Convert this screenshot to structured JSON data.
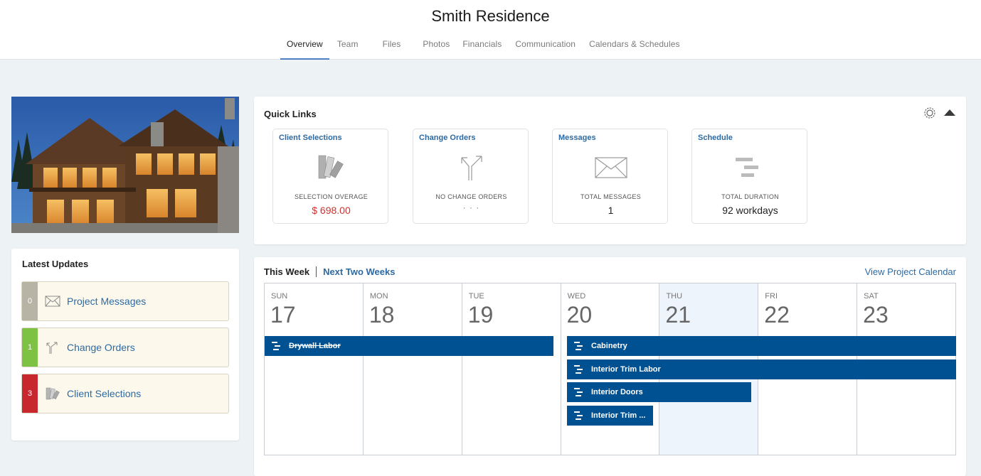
{
  "project": {
    "title": "Smith Residence"
  },
  "nav": {
    "tabs": [
      {
        "label": "Overview",
        "active": true
      },
      {
        "label": "Team"
      },
      {
        "label": "Files"
      },
      {
        "label": "Photos"
      },
      {
        "label": "Financials"
      },
      {
        "label": "Communication"
      },
      {
        "label": "Calendars & Schedules"
      }
    ]
  },
  "updates": {
    "title": "Latest Updates",
    "items": [
      {
        "count": "0",
        "label": "Project Messages",
        "icon": "envelope-icon",
        "color": "#b7b4a6"
      },
      {
        "count": "1",
        "label": "Change Orders",
        "icon": "change-order-arrows-icon",
        "color": "#7dc242"
      },
      {
        "count": "3",
        "label": "Client Selections",
        "icon": "swatch-icon",
        "color": "#c8272d"
      }
    ]
  },
  "quick_links": {
    "title": "Quick Links",
    "tiles": [
      {
        "name": "Client Selections",
        "icon": "swatch-icon",
        "sub": "SELECTION OVERAGE",
        "value": "$ 698.00"
      },
      {
        "name": "Change Orders",
        "icon": "change-order-arrows-icon",
        "sub": "NO CHANGE ORDERS",
        "value": "· · ·"
      },
      {
        "name": "Messages",
        "icon": "envelope-icon",
        "sub": "TOTAL MESSAGES",
        "value": "1"
      },
      {
        "name": "Schedule",
        "icon": "gantt-icon",
        "sub": "TOTAL DURATION",
        "value": "92 workdays"
      }
    ]
  },
  "calendar": {
    "tab_this_week": "This Week",
    "tab_next_two": "Next Two Weeks",
    "view_link": "View Project Calendar",
    "days": [
      {
        "dow": "SUN",
        "num": "17"
      },
      {
        "dow": "MON",
        "num": "18"
      },
      {
        "dow": "TUE",
        "num": "19"
      },
      {
        "dow": "WED",
        "num": "20"
      },
      {
        "dow": "THU",
        "num": "21",
        "today": true
      },
      {
        "dow": "FRI",
        "num": "22"
      },
      {
        "dow": "SAT",
        "num": "23"
      }
    ],
    "events": [
      {
        "label": "Drywall Labor",
        "strikethrough": true
      },
      {
        "label": "Cabinetry"
      },
      {
        "label": "Interior Trim Labor"
      },
      {
        "label": "Interior Doors"
      },
      {
        "label": "Interior Trim ..."
      }
    ],
    "event_color": "#005191",
    "today_color": "#eef4fb"
  },
  "colors": {
    "link": "#2d6aa3",
    "accent_tab": "#4d7fc2",
    "overage_red": "#d0312d"
  }
}
